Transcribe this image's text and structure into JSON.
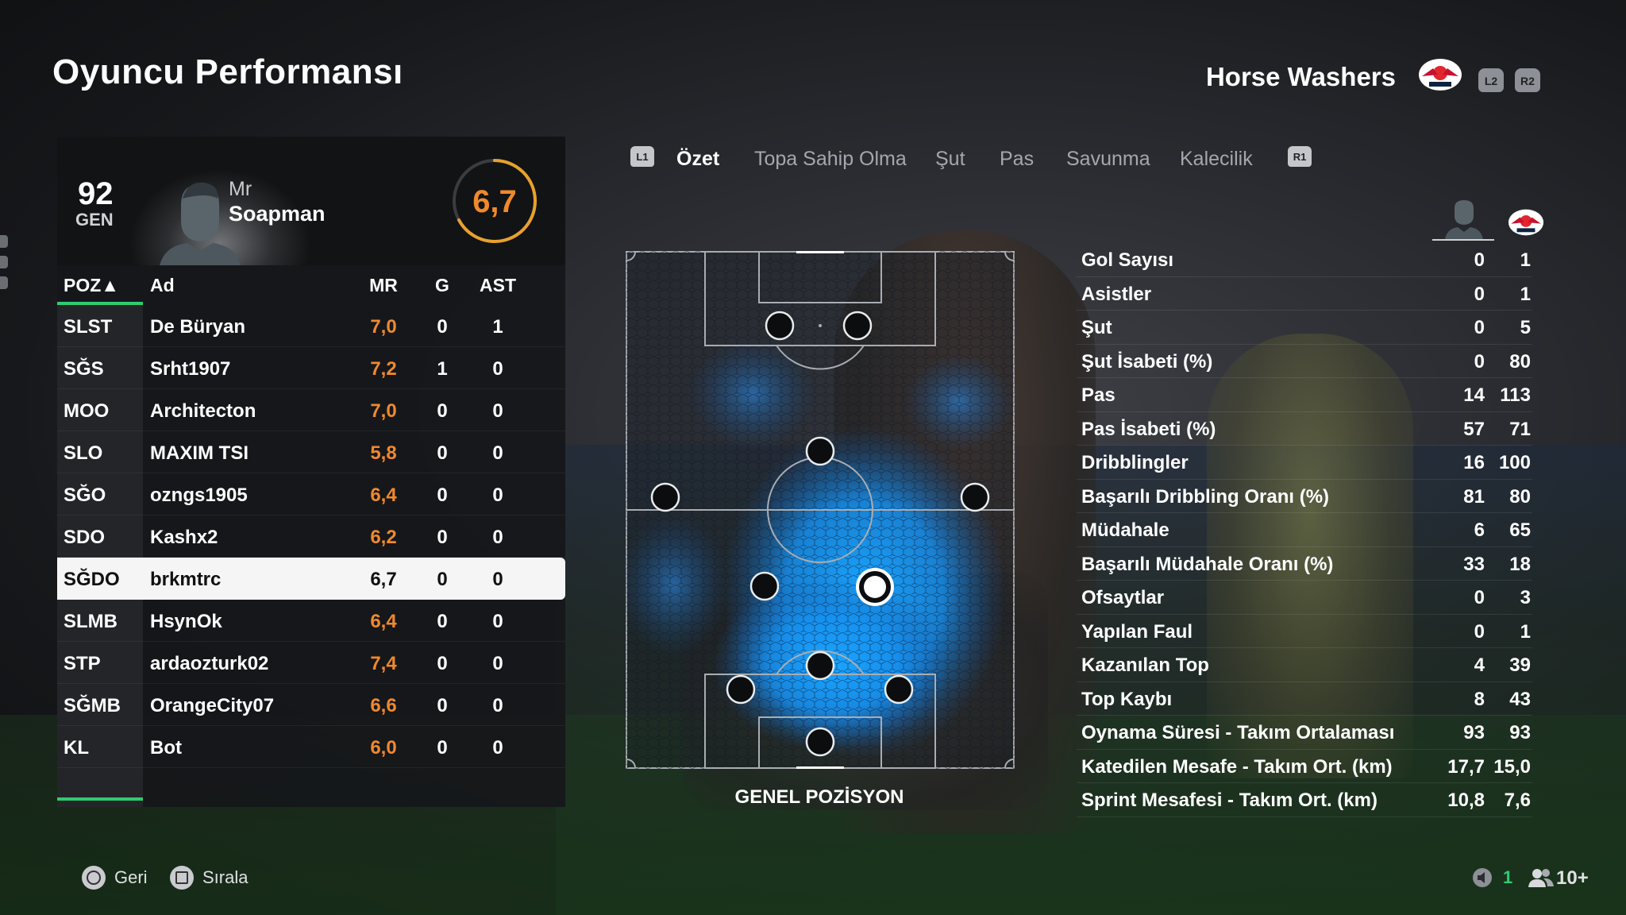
{
  "header": {
    "title": "Oyuncu Performansı",
    "team_name": "Horse Washers",
    "btn_l2": "L2",
    "btn_r2": "R2"
  },
  "player_card": {
    "ovr": "92",
    "ovr_label": "GEN",
    "first_name": "Mr",
    "last_name": "Soapman",
    "rating": "6,7",
    "rating_color": "#f0892c"
  },
  "table": {
    "headers": {
      "pos": "POZ▲",
      "name": "Ad",
      "mr": "MR",
      "g": "G",
      "ast": "AST"
    },
    "rows": [
      {
        "pos": "SLST",
        "name": "De Büryan",
        "mr": "7,0",
        "g": "0",
        "ast": "1"
      },
      {
        "pos": "SĞS",
        "name": "Srht1907",
        "mr": "7,2",
        "g": "1",
        "ast": "0"
      },
      {
        "pos": "MOO",
        "name": "Architecton",
        "mr": "7,0",
        "g": "0",
        "ast": "0"
      },
      {
        "pos": "SLO",
        "name": "MAXIM TSI",
        "mr": "5,8",
        "g": "0",
        "ast": "0"
      },
      {
        "pos": "SĞO",
        "name": "ozngs1905",
        "mr": "6,4",
        "g": "0",
        "ast": "0"
      },
      {
        "pos": "SDO",
        "name": "Kashx2",
        "mr": "6,2",
        "g": "0",
        "ast": "0"
      },
      {
        "pos": "SĞDO",
        "name": "brkmtrc",
        "mr": "6,7",
        "g": "0",
        "ast": "0"
      },
      {
        "pos": "SLMB",
        "name": "HsynOk",
        "mr": "6,4",
        "g": "0",
        "ast": "0"
      },
      {
        "pos": "STP",
        "name": "ardaozturk02",
        "mr": "7,4",
        "g": "0",
        "ast": "0"
      },
      {
        "pos": "SĞMB",
        "name": "OrangeCity07",
        "mr": "6,6",
        "g": "0",
        "ast": "0"
      },
      {
        "pos": "KL",
        "name": "Bot",
        "mr": "6,0",
        "g": "0",
        "ast": "0"
      }
    ],
    "selected_index": 6
  },
  "tabs": {
    "left_btn": "L1",
    "right_btn": "R1",
    "items": [
      "Özet",
      "Topa Sahip Olma",
      "Şut",
      "Pas",
      "Savunma",
      "Kalecilik"
    ],
    "active": 0
  },
  "pitch": {
    "label": "GENEL POZİSYON",
    "heatmap_color": "#1e9bff"
  },
  "stats": {
    "rows": [
      {
        "label": "Gol Sayısı",
        "player": "0",
        "team": "1"
      },
      {
        "label": "Asistler",
        "player": "0",
        "team": "1"
      },
      {
        "label": "Şut",
        "player": "0",
        "team": "5"
      },
      {
        "label": "Şut İsabeti (%)",
        "player": "0",
        "team": "80"
      },
      {
        "label": "Pas",
        "player": "14",
        "team": "113"
      },
      {
        "label": "Pas İsabeti (%)",
        "player": "57",
        "team": "71"
      },
      {
        "label": "Dribblingler",
        "player": "16",
        "team": "100"
      },
      {
        "label": "Başarılı Dribbling Oranı (%)",
        "player": "81",
        "team": "80"
      },
      {
        "label": "Müdahale",
        "player": "6",
        "team": "65"
      },
      {
        "label": "Başarılı Müdahale Oranı (%)",
        "player": "33",
        "team": "18"
      },
      {
        "label": "Ofsaytlar",
        "player": "0",
        "team": "3"
      },
      {
        "label": "Yapılan Faul",
        "player": "0",
        "team": "1"
      },
      {
        "label": "Kazanılan Top",
        "player": "4",
        "team": "39"
      },
      {
        "label": "Top Kaybı",
        "player": "8",
        "team": "43"
      },
      {
        "label": "Oynama Süresi - Takım Ortalaması",
        "player": "93",
        "team": "93"
      },
      {
        "label": "Katedilen Mesafe - Takım Ort. (km)",
        "player": "17,7",
        "team": "15,0"
      },
      {
        "label": "Sprint Mesafesi - Takım Ort. (km)",
        "player": "10,8",
        "team": "7,6"
      }
    ]
  },
  "footer": {
    "back": "Geri",
    "sort": "Sırala",
    "voice_count": "1",
    "players_count": "10+"
  }
}
